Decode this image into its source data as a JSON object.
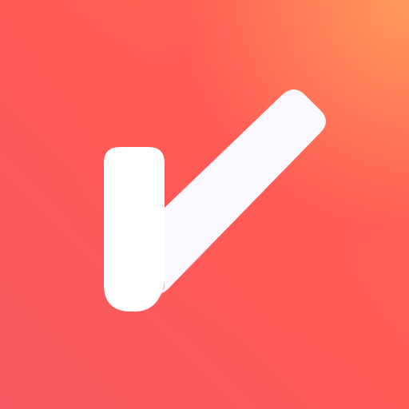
{
  "icon": {
    "name": "checkmark-icon",
    "colors": {
      "gradient_top_right": "#ff9a5a",
      "gradient_center": "#ff5a55",
      "gradient_bottom_left": "#f75a62",
      "check_fill": "#ffffff",
      "check_fold_fill": "#fbf7ff"
    }
  }
}
